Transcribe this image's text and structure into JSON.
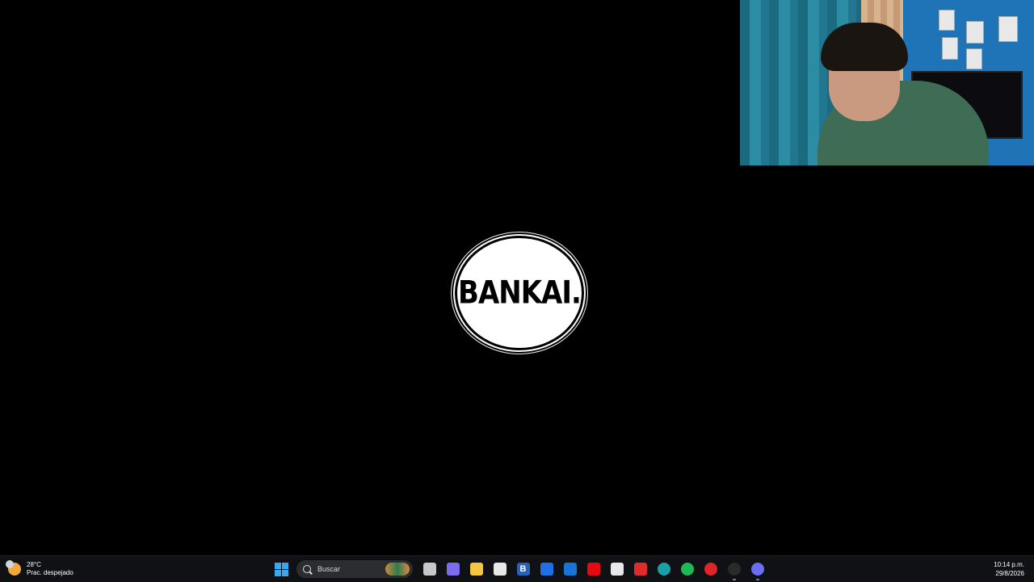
{
  "desktop": {
    "logo_text": "BANKAI."
  },
  "taskbar": {
    "weather": {
      "temperature": "28°C",
      "condition": "Prac. despejado"
    },
    "search": {
      "label": "Buscar"
    },
    "apps": [
      {
        "name": "task-view",
        "color": "#c8c8c8"
      },
      {
        "name": "copilot",
        "color": "#7b6cf0"
      },
      {
        "name": "file-explorer",
        "color": "#f5c542"
      },
      {
        "name": "news-app",
        "color": "#e8e8e8"
      },
      {
        "name": "b-app",
        "color": "#2b5fb8",
        "glyph": "B"
      },
      {
        "name": "dropbox",
        "color": "#1f6fe6"
      },
      {
        "name": "outlook",
        "color": "#1a73d8"
      },
      {
        "name": "netflix",
        "color": "#e50914"
      },
      {
        "name": "microsoft-store",
        "color": "#e8e8e8"
      },
      {
        "name": "wps-office",
        "color": "#e02b2b"
      },
      {
        "name": "edge",
        "color": "#1aa1a8"
      },
      {
        "name": "spotify",
        "color": "#1db954"
      },
      {
        "name": "opera",
        "color": "#e0242a"
      },
      {
        "name": "obs",
        "color": "#2a2a2a"
      },
      {
        "name": "discord",
        "color": "#6b6ef2"
      }
    ],
    "clock": {
      "time": "10:14 p.m.",
      "date": "29/8/2026"
    }
  }
}
